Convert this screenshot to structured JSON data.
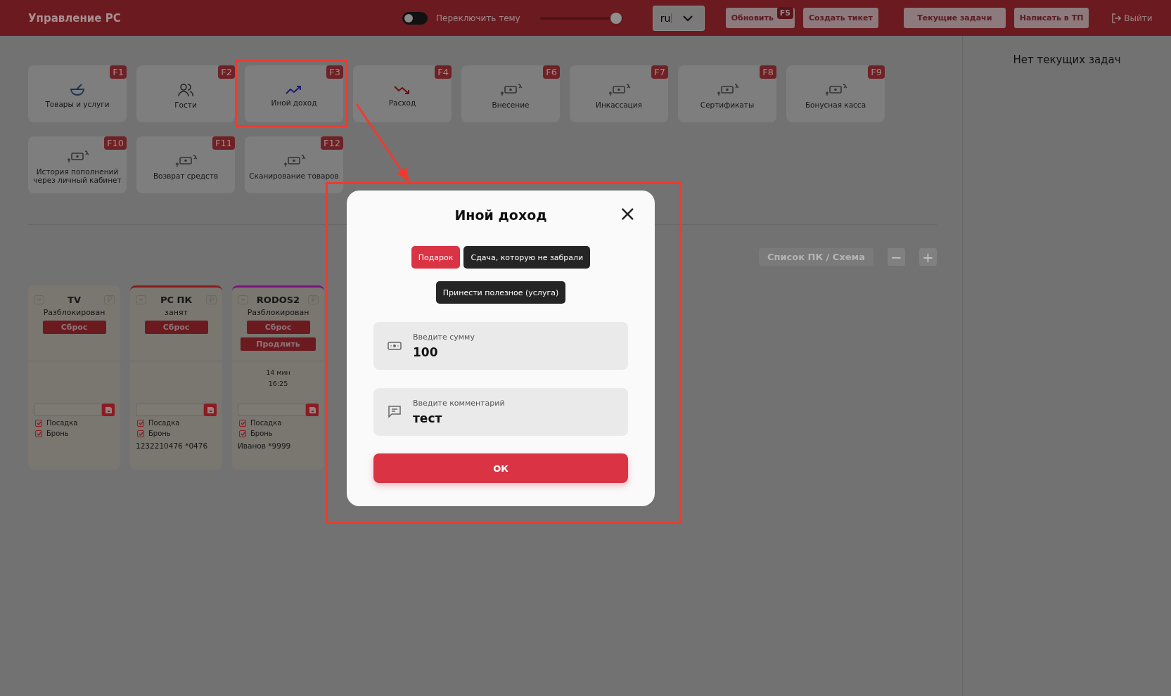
{
  "header": {
    "title": "Управление PC",
    "theme_toggle": {
      "label": "Переключить тему",
      "on": false
    },
    "slider": {
      "level": 0.92
    },
    "language": {
      "value": "ru"
    },
    "buttons": [
      {
        "label": "Обновить",
        "badge": "F5"
      },
      {
        "label": "Создать тикет"
      },
      {
        "label": "Текущие задачи"
      },
      {
        "label": "Написать в ТП"
      }
    ],
    "logout": "Выйти"
  },
  "tiles": [
    {
      "label": "Товары и услуги",
      "key": "F1",
      "kind": "bowl"
    },
    {
      "label": "Гости",
      "key": "F2",
      "kind": "guests"
    },
    {
      "label": "Иной доход",
      "key": "F3",
      "kind": "income"
    },
    {
      "label": "Расход",
      "key": "F4",
      "kind": "expense"
    },
    {
      "label": "Внесение",
      "key": "F6",
      "kind": "cash"
    },
    {
      "label": "Инкассация",
      "key": "F7",
      "kind": "cash"
    },
    {
      "label": "Сертификаты",
      "key": "F8",
      "kind": "cash"
    },
    {
      "label": "Бонусная касса",
      "key": "F9",
      "kind": "cash"
    },
    {
      "label": "История пополнений через личный кабинет",
      "key": "F10",
      "kind": "cash"
    },
    {
      "label": "Возврат средств",
      "key": "F11",
      "kind": "cash"
    },
    {
      "label": "Сканирование товаров",
      "key": "F12",
      "kind": "cash"
    }
  ],
  "view_switch": "Список ПК / Схема",
  "zoom_buttons": [
    "−",
    "+"
  ],
  "pc_cards": [
    {
      "name": "TV",
      "status": "Разблокирован",
      "actions": [
        "Сброс"
      ],
      "checks": [
        {
          "label": "Посадка",
          "checked": true
        },
        {
          "label": "Бронь",
          "checked": true
        }
      ]
    },
    {
      "name": "PC ПК",
      "status": "занят",
      "color": "#8b1c1c",
      "actions": [
        "Сброс"
      ],
      "checks": [
        {
          "label": "Посадка",
          "checked": true
        },
        {
          "label": "Бронь",
          "checked": true
        }
      ],
      "footer": "1232210476 *0476"
    },
    {
      "name": "RODOS2",
      "status": "Разблокирован",
      "color": "#7a1580",
      "actions": [
        "Сброс",
        "Продлить"
      ],
      "info": [
        "14 мин",
        "16:25"
      ],
      "checks": [
        {
          "label": "Посадка",
          "checked": true
        },
        {
          "label": "Бронь",
          "checked": true
        }
      ],
      "footer": "Иванов *9999"
    }
  ],
  "tasks_panel": {
    "empty_text": "Нет текущих задач"
  },
  "modal": {
    "title": "Иной доход",
    "close": "×",
    "options": [
      {
        "label": "Подарок",
        "selected": true
      },
      {
        "label": "Сдача, которую не забрали",
        "selected": false
      },
      {
        "label": "Принести полезное (услуга)",
        "selected": false
      }
    ],
    "fields": [
      {
        "kind": "money",
        "label": "Введите сумму",
        "value": "100"
      },
      {
        "kind": "comment",
        "label": "Введите комментарий",
        "value": "тест"
      }
    ],
    "submit": "ОК"
  }
}
